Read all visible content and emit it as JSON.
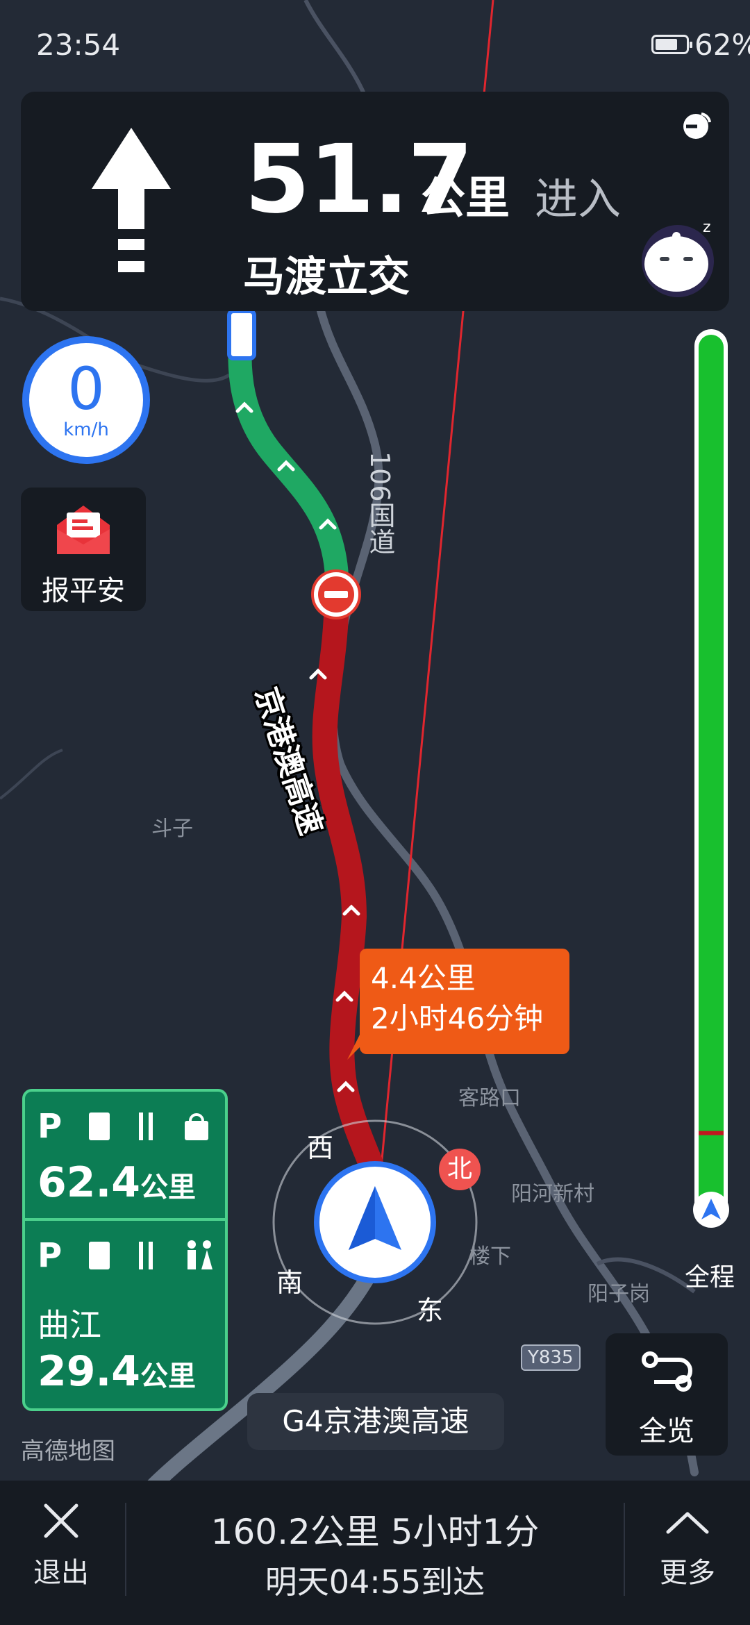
{
  "status_bar": {
    "time": "23:54",
    "battery": "62%"
  },
  "navigation": {
    "distance": "51.7",
    "distance_unit": "公里",
    "action": "进入",
    "next_road": "马渡立交"
  },
  "speedometer": {
    "value": "0",
    "unit": "km/h"
  },
  "safety_button": {
    "label": "报平安"
  },
  "map": {
    "highway_label": "京港澳高速",
    "national_road_label": "106国道",
    "place_labels": {
      "douzi": "斗子",
      "kelukou": "客路口",
      "yanghe": "阳河新村",
      "louxia": "楼下",
      "yangzigang": "阳子岗",
      "road_code": "Y835"
    },
    "brand": "高德地图",
    "current_road": "G4京港澳高速",
    "route_segment_colors": {
      "clear": "#1fa863",
      "congested": "#b5161d"
    }
  },
  "eta_bubble": {
    "distance": "4.4公里",
    "duration": "2小时46分钟"
  },
  "compass": {
    "west": "西",
    "south": "南",
    "east": "东",
    "north": "北"
  },
  "progress": {
    "label": "全程",
    "completed_fraction": 0.0,
    "congestion_marker_fraction": 0.91
  },
  "service_areas": [
    {
      "distance": "62.4",
      "unit": "公里",
      "icons": [
        "parking-icon",
        "fuel-icon",
        "dining-icon",
        "shopping-icon"
      ]
    },
    {
      "name": "曲江",
      "distance": "29.4",
      "unit": "公里",
      "icons": [
        "parking-icon",
        "fuel-icon",
        "dining-icon",
        "restroom-icon"
      ]
    }
  ],
  "overview_button": {
    "label": "全览"
  },
  "bottom_bar": {
    "exit_label": "退出",
    "summary": "160.2公里  5小时1分",
    "arrival": "明天04:55到达",
    "more_label": "更多"
  }
}
